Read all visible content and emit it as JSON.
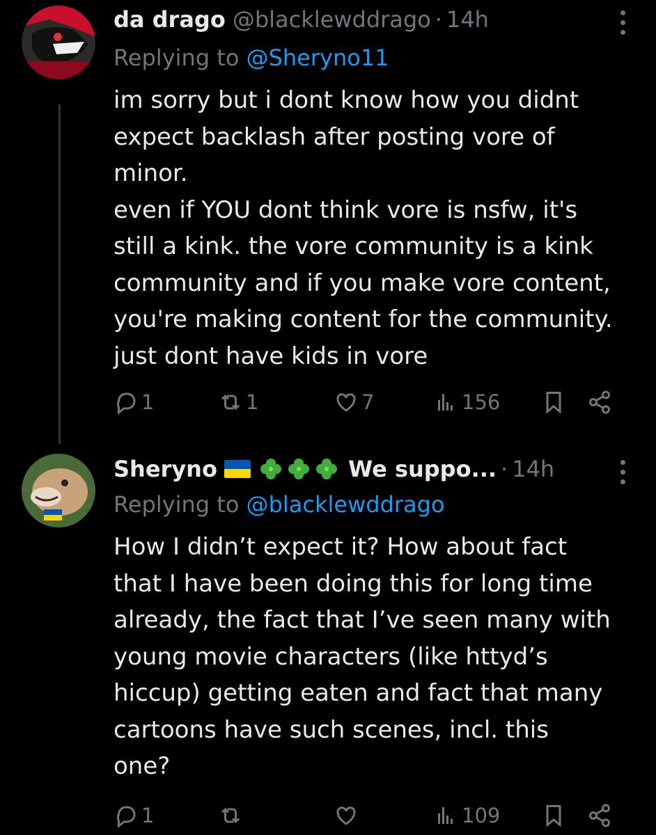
{
  "colors": {
    "background": "#000000",
    "text": "#e7e9ea",
    "muted": "#71767b",
    "link": "#1d9bf0",
    "line": "#333639"
  },
  "tweets": [
    {
      "name": "da drago",
      "handle": "@blacklewddrago",
      "separator": "·",
      "time": "14h",
      "replying_label": "Replying to",
      "replying_to": "@Sheryno11",
      "body": "im sorry but i dont know how you didnt\nexpect backlash after posting vore of\nminor.\neven if YOU dont think vore is nsfw, it's\nstill a kink. the vore community is a kink\ncommunity and if you make vore content,\nyou're making content for the community.\njust dont have kids in vore",
      "counts": {
        "replies": "1",
        "retweets": "1",
        "likes": "7",
        "views": "156"
      }
    },
    {
      "name": "Sheryno",
      "name_suffix": "We suppo...",
      "handle": "",
      "separator": "·",
      "time": "14h",
      "replying_label": "Replying to",
      "replying_to": "@blacklewddrago",
      "body": "How I didn’t expect it? How about fact\nthat I have been doing this for long time\nalready, the fact that I’ve seen many with\nyoung movie characters (like httyd’s\nhiccup) getting eaten and fact that many\ncartoons have such scenes, incl. this\none?",
      "counts": {
        "replies": "1",
        "retweets": "",
        "likes": "",
        "views": "109"
      }
    }
  ],
  "icons": [
    "more-icon",
    "reply-icon",
    "retweet-icon",
    "like-icon",
    "views-icon",
    "bookmark-icon",
    "share-icon",
    "ukraine-flag-icon",
    "clover-icon"
  ]
}
